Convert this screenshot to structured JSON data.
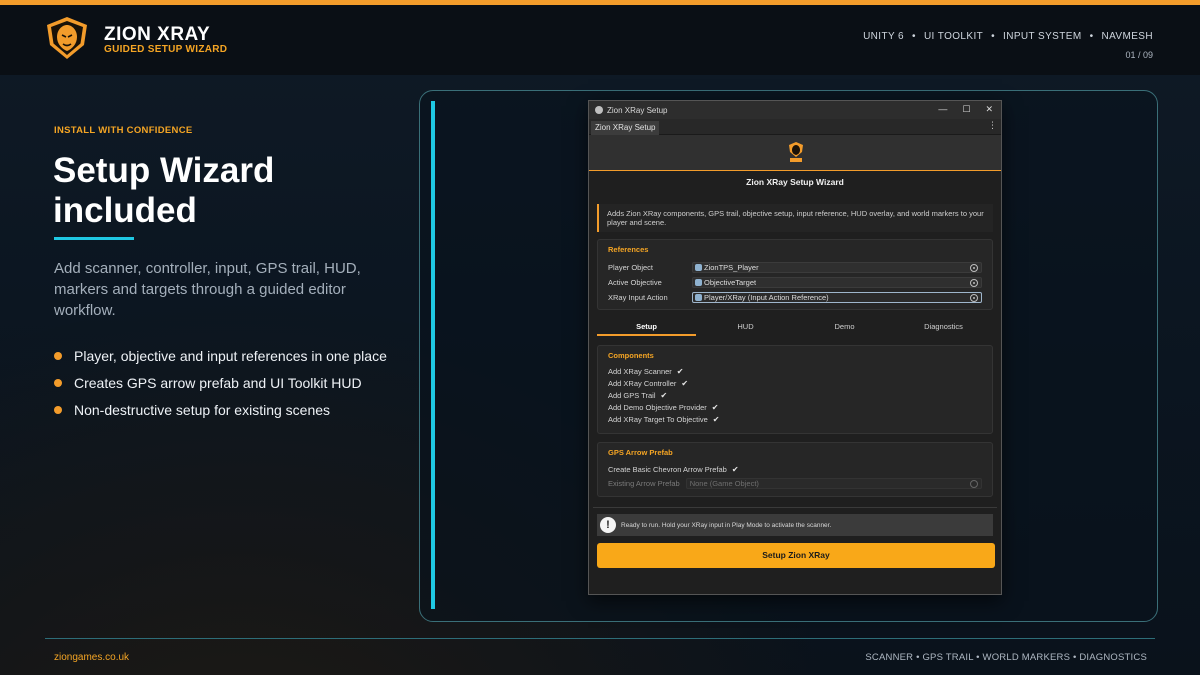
{
  "brand": {
    "title": "ZION XRAY",
    "subtitle": "GUIDED SETUP WIZARD",
    "accent": "#f39c2b",
    "cyan": "#1fc8e3"
  },
  "nav": {
    "tags": [
      "UNITY 6",
      "UI TOOLKIT",
      "INPUT SYSTEM",
      "NAVMESH"
    ],
    "page": "01 / 09"
  },
  "hero": {
    "eyebrow": "INSTALL WITH CONFIDENCE",
    "headline": "Setup Wizard included",
    "lead": "Add scanner, controller, input, GPS trail, HUD, markers and targets through a guided editor workflow.",
    "bullets": [
      "Player, objective and input references in one place",
      "Creates GPS arrow prefab and UI Toolkit HUD",
      "Non-destructive setup for existing scenes"
    ]
  },
  "window": {
    "title": "Zion XRay Setup",
    "tab": "Zion XRay Setup",
    "controls": [
      "—",
      "☐",
      "✕"
    ],
    "wizard_title": "Zion XRay Setup Wizard",
    "info": "Adds Zion XRay components, GPS trail, objective setup, input reference, HUD overlay, and world markers to your player and scene.",
    "references": {
      "heading": "References",
      "rows": [
        {
          "label": "Player Object",
          "value": "ZionTPS_Player"
        },
        {
          "label": "Active Objective",
          "value": "ObjectiveTarget"
        },
        {
          "label": "XRay Input Action",
          "value": "Player/XRay (Input Action Reference)"
        }
      ]
    },
    "tabs": [
      "Setup",
      "HUD",
      "Demo",
      "Diagnostics"
    ],
    "active_tab": "Setup",
    "components": {
      "heading": "Components",
      "items": [
        {
          "label": "Add XRay Scanner",
          "checked": true
        },
        {
          "label": "Add XRay Controller",
          "checked": true
        },
        {
          "label": "Add GPS Trail",
          "checked": true
        },
        {
          "label": "Add Demo Objective Provider",
          "checked": true
        },
        {
          "label": "Add XRay Target To Objective",
          "checked": true
        }
      ]
    },
    "gps": {
      "heading": "GPS Arrow Prefab",
      "create_label": "Create Basic Chevron Arrow Prefab",
      "create_checked": true,
      "existing_label": "Existing Arrow Prefab",
      "existing_value": "None (Game Object)"
    },
    "status": "Ready to run. Hold your XRay input in Play Mode to activate the scanner.",
    "run_button": "Setup Zion XRay"
  },
  "footer": {
    "site": "ziongames.co.uk",
    "features": "SCANNER • GPS TRAIL • WORLD MARKERS • DIAGNOSTICS"
  }
}
